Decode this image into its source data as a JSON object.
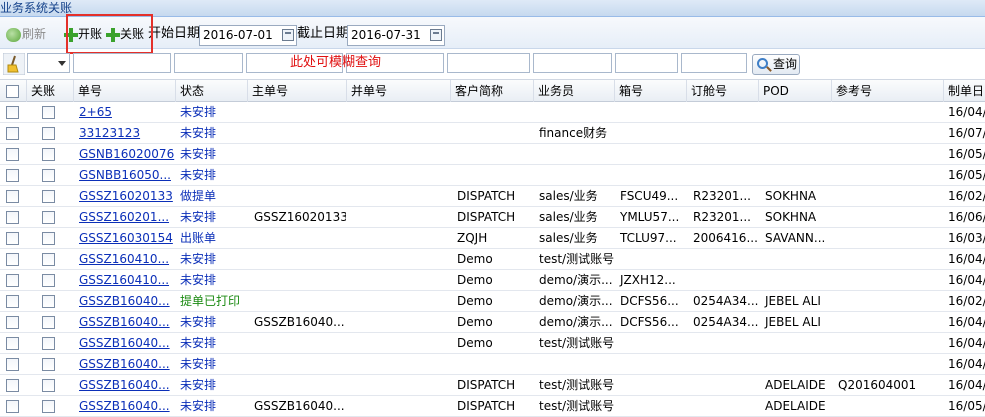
{
  "window": {
    "title": "业务系统关账"
  },
  "toolbar": {
    "refresh_label": "刷新",
    "open_label": "开账",
    "close_label": "关账",
    "start_date_label": "开始日期",
    "start_date_value": "2016-07-01",
    "end_date_label": "截止日期",
    "end_date_value": "2016-07-31"
  },
  "filter": {
    "hint": "此处可模糊查询",
    "query_label": "查询"
  },
  "table": {
    "columns": [
      "关账",
      "单号",
      "状态",
      "主单号",
      "并单号",
      "客户简称",
      "业务员",
      "箱号",
      "订舱号",
      "POD",
      "参考号",
      "制单日"
    ],
    "rows": [
      {
        "no": "2+65",
        "status": "未安排",
        "master": "",
        "merge": "",
        "customer": "",
        "sales": "",
        "container": "",
        "booking": "",
        "pod": "",
        "ref": "",
        "date": "16/04/"
      },
      {
        "no": "33123123",
        "status": "未安排",
        "master": "",
        "merge": "",
        "customer": "",
        "sales": "finance财务",
        "container": "",
        "booking": "",
        "pod": "",
        "ref": "",
        "date": "16/07/"
      },
      {
        "no": "GSNB16020076",
        "status": "未安排",
        "master": "",
        "merge": "",
        "customer": "",
        "sales": "",
        "container": "",
        "booking": "",
        "pod": "",
        "ref": "",
        "date": "16/05/"
      },
      {
        "no": "GSNBB16050...",
        "status": "未安排",
        "master": "",
        "merge": "",
        "customer": "",
        "sales": "",
        "container": "",
        "booking": "",
        "pod": "",
        "ref": "",
        "date": "16/05/"
      },
      {
        "no": "GSSZ16020133",
        "status": "做提单",
        "master": "",
        "merge": "",
        "customer": "DISPATCH",
        "sales": "sales/业务",
        "container": "FSCU49...",
        "booking": "R23201...",
        "pod": "SOKHNA",
        "ref": "",
        "date": "16/02/"
      },
      {
        "no": "GSSZ160201...",
        "status": "未安排",
        "master": "GSSZ16020133",
        "merge": "",
        "customer": "DISPATCH",
        "sales": "sales/业务",
        "container": "YMLU57...",
        "booking": "R23201...",
        "pod": "SOKHNA",
        "ref": "",
        "date": "16/06/"
      },
      {
        "no": "GSSZ16030154",
        "status": "出账单",
        "master": "",
        "merge": "",
        "customer": "ZQJH",
        "sales": "sales/业务",
        "container": "TCLU97...",
        "booking": "2006416...",
        "pod": "SAVANN...",
        "ref": "",
        "date": "16/03/"
      },
      {
        "no": "GSSZ160410...",
        "status": "未安排",
        "master": "",
        "merge": "",
        "customer": "Demo",
        "sales": "test/测试账号",
        "container": "",
        "booking": "",
        "pod": "",
        "ref": "",
        "date": "16/04/"
      },
      {
        "no": "GSSZ160410...",
        "status": "未安排",
        "master": "",
        "merge": "",
        "customer": "Demo",
        "sales": "demo/演示...",
        "container": "JZXH12...",
        "booking": "",
        "pod": "",
        "ref": "",
        "date": "16/04/"
      },
      {
        "no": "GSSZB16040...",
        "status": "提单已打印",
        "master": "",
        "merge": "",
        "customer": "Demo",
        "sales": "demo/演示...",
        "container": "DCFS56...",
        "booking": "0254A34...",
        "pod": "JEBEL ALI",
        "ref": "",
        "date": "16/02/"
      },
      {
        "no": "GSSZB16040...",
        "status": "未安排",
        "master": "GSSZB16040...",
        "merge": "",
        "customer": "Demo",
        "sales": "demo/演示...",
        "container": "DCFS56...",
        "booking": "0254A34...",
        "pod": "JEBEL ALI",
        "ref": "",
        "date": "16/04/"
      },
      {
        "no": "GSSZB16040...",
        "status": "未安排",
        "master": "",
        "merge": "",
        "customer": "Demo",
        "sales": "test/测试账号",
        "container": "",
        "booking": "",
        "pod": "",
        "ref": "",
        "date": "16/04/"
      },
      {
        "no": "GSSZB16040...",
        "status": "未安排",
        "master": "",
        "merge": "",
        "customer": "",
        "sales": "",
        "container": "",
        "booking": "",
        "pod": "",
        "ref": "",
        "date": "16/04/"
      },
      {
        "no": "GSSZB16040...",
        "status": "未安排",
        "master": "",
        "merge": "",
        "customer": "DISPATCH",
        "sales": "test/测试账号",
        "container": "",
        "booking": "",
        "pod": "ADELAIDE",
        "ref": "Q201604001",
        "date": "16/04/"
      },
      {
        "no": "GSSZB16040...",
        "status": "未安排",
        "master": "GSSZB16040...",
        "merge": "",
        "customer": "DISPATCH",
        "sales": "test/测试账号",
        "container": "",
        "booking": "",
        "pod": "ADELAIDE",
        "ref": "",
        "date": "16/05/"
      }
    ]
  },
  "colors": {
    "link": "#0b2fb8",
    "status_green": "#1b8a12",
    "hint_red": "#e01010",
    "highlight_box": "#e4302a"
  }
}
